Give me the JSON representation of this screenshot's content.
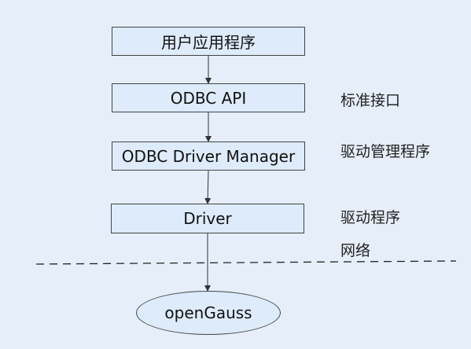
{
  "diagram": {
    "nodes": {
      "app": "用户应用程序",
      "api": "ODBC API",
      "manager": "ODBC Driver Manager",
      "driver": "Driver",
      "db": "openGauss"
    },
    "labels": {
      "api": "标准接口",
      "manager": "驱动管理程序",
      "driver": "驱动程序",
      "network": "网络"
    }
  }
}
